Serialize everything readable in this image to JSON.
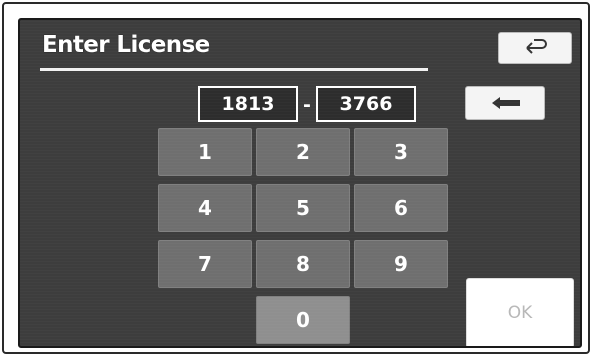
{
  "header": {
    "title": "Enter License"
  },
  "license": {
    "part1": "1813",
    "separator": "-",
    "part2": "3766"
  },
  "keypad": {
    "keys": [
      "1",
      "2",
      "3",
      "4",
      "5",
      "6",
      "7",
      "8",
      "9",
      "0"
    ]
  },
  "buttons": {
    "back_icon": "return-arrow-icon",
    "backspace_icon": "backspace-arrow-icon",
    "ok_label": "OK"
  },
  "colors": {
    "screen_bg": "#3d3d3d",
    "key_bg": "#6f6f6f",
    "text": "#ffffff"
  }
}
